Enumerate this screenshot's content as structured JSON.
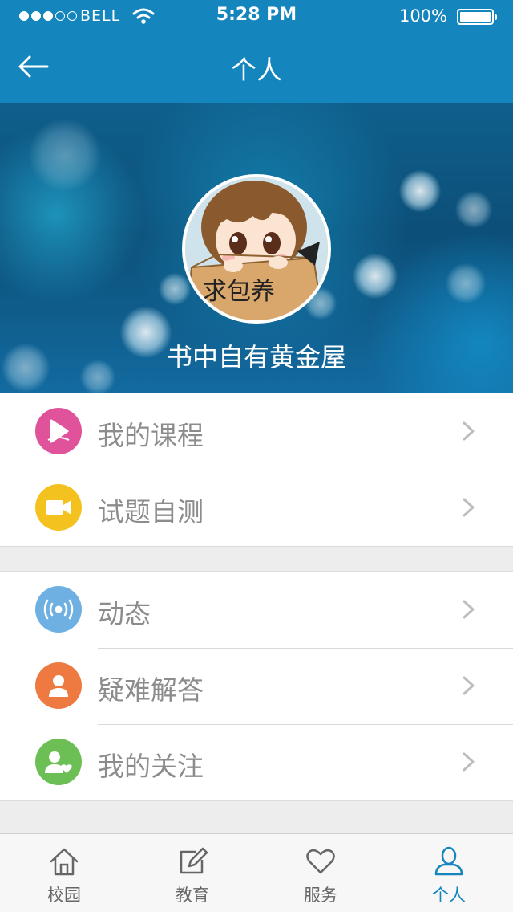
{
  "status_bar": {
    "carrier": "BELL",
    "time": "5:28 PM",
    "battery": "100%"
  },
  "nav": {
    "title": "个人"
  },
  "profile": {
    "username": "书中自有黄金屋",
    "avatar_text": "求包养"
  },
  "menu_groups": [
    [
      {
        "label": "我的课程",
        "icon": "play-bell-icon",
        "color": "#e0539a"
      },
      {
        "label": "试题自测",
        "icon": "video-camera-icon",
        "color": "#f4c21f"
      }
    ],
    [
      {
        "label": "动态",
        "icon": "broadcast-icon",
        "color": "#6fb0e3"
      },
      {
        "label": "疑难解答",
        "icon": "person-icon",
        "color": "#ef7a41"
      },
      {
        "label": "我的关注",
        "icon": "person-heart-icon",
        "color": "#6cbf55"
      }
    ]
  ],
  "tabs": [
    {
      "label": "校园",
      "icon": "home-icon",
      "active": false
    },
    {
      "label": "教育",
      "icon": "edit-icon",
      "active": false
    },
    {
      "label": "服务",
      "icon": "heart-icon",
      "active": false
    },
    {
      "label": "个人",
      "icon": "user-icon",
      "active": true
    }
  ],
  "colors": {
    "nav_bar": "#1585be",
    "active_tab": "#1585be"
  }
}
